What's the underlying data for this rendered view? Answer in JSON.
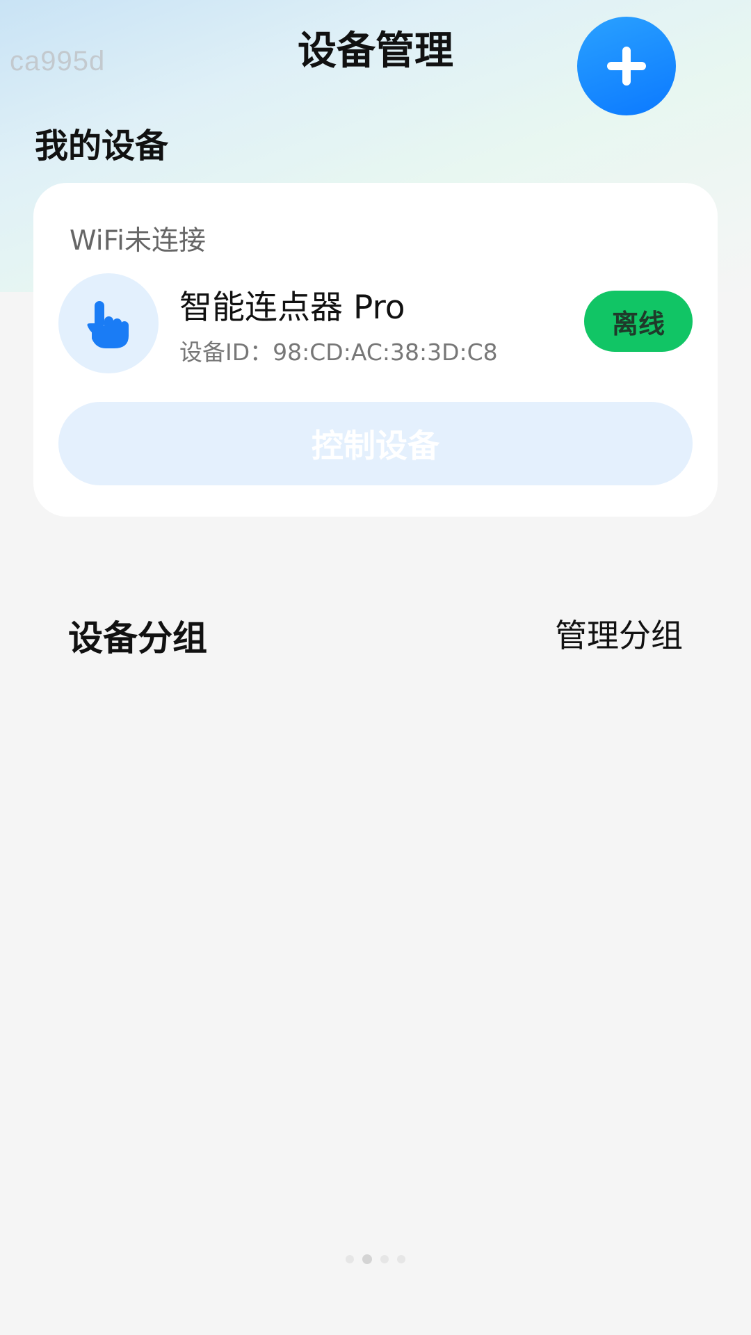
{
  "watermark": "ca995d",
  "header": {
    "title": "设备管理",
    "add_icon": "plus-icon"
  },
  "my_devices": {
    "section_title": "我的设备",
    "card": {
      "wifi_status": "WiFi未连接",
      "device_icon": "pointing-hand-icon",
      "device_name": "智能连点器 Pro",
      "device_id": "设备ID：98:CD:AC:38:3D:C8",
      "status": "离线",
      "control_button_label": "控制设备"
    }
  },
  "groups": {
    "title": "设备分组",
    "manage_label": "管理分组"
  },
  "colors": {
    "accent_blue": "#0b79ff",
    "status_green": "#11c565",
    "control_button_bg": "#e4f0fd"
  }
}
